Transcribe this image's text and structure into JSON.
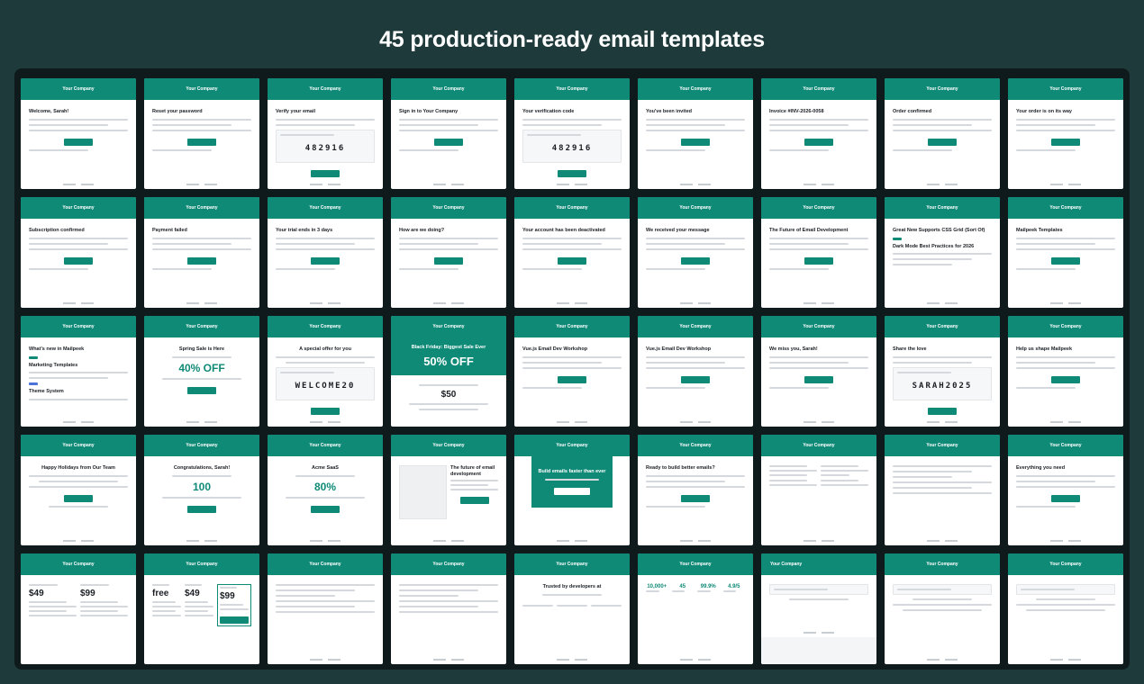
{
  "page": {
    "title": "45 production-ready email templates"
  },
  "card_header": "Your Company",
  "cards": [
    {
      "title": "Welcome, Sarah!"
    },
    {
      "title": "Reset your password"
    },
    {
      "title": "Verify your email",
      "code": "482916"
    },
    {
      "title": "Sign in to Your Company"
    },
    {
      "title": "Your verification code",
      "code": "482916"
    },
    {
      "title": "You've been invited"
    },
    {
      "title": "Invoice #INV-2026-0058"
    },
    {
      "title": "Order confirmed"
    },
    {
      "title": "Your order is on its way"
    },
    {
      "title": "Subscription confirmed"
    },
    {
      "title": "Payment failed"
    },
    {
      "title": "Your trial ends in 3 days"
    },
    {
      "title": "How are we doing?"
    },
    {
      "title": "Your account has been deactivated"
    },
    {
      "title": "We received your message"
    },
    {
      "title": "The Future of Email Development"
    },
    {
      "title": "Great New Supports CSS Grid (Sort Of)",
      "sub": "Dark Mode Best Practices for 2026"
    },
    {
      "title": "Mailpeek Templates"
    },
    {
      "title": "What's new in Mailpeek",
      "sub": "Marketing Templates",
      "sub2": "Theme System"
    },
    {
      "title": "Spring Sale is Here",
      "big": "40% OFF"
    },
    {
      "title": "A special offer for you",
      "code": "WELCOME20"
    },
    {
      "title": "Black Friday: Biggest Sale Ever",
      "big": "50% OFF",
      "price": "$50"
    },
    {
      "title": "Vue.js Email Dev Workshop"
    },
    {
      "title": "Vue.js Email Dev Workshop"
    },
    {
      "title": "We miss you, Sarah!"
    },
    {
      "title": "Share the love",
      "code": "SARAH2025"
    },
    {
      "title": "Help us shape Mailpeek"
    },
    {
      "title": "Happy Holidays from Our Team"
    },
    {
      "title": "Congratulations, Sarah!",
      "big": "100"
    },
    {
      "title": "Acme SaaS",
      "big": "80%"
    },
    {
      "title": "The future of email development"
    },
    {
      "title": "Build emails faster than ever"
    },
    {
      "title": "Ready to build better emails?"
    },
    {
      "title": ""
    },
    {
      "title": ""
    },
    {
      "title": "Everything you need"
    },
    {
      "title": "",
      "price": "$49",
      "price2": "$99"
    },
    {
      "title": "",
      "price": "free",
      "price2": "$49",
      "price3": "$99"
    },
    {
      "title": ""
    },
    {
      "title": ""
    },
    {
      "title": "Trusted by developers at"
    },
    {
      "title": "",
      "stats": [
        "10,000+",
        "45",
        "99.9%",
        "4.9/5"
      ]
    },
    {
      "title": ""
    },
    {
      "title": ""
    },
    {
      "title": ""
    }
  ],
  "colors": {
    "brand": "#0f8a77",
    "background": "#1e3a3a",
    "board": "#0f1a1c"
  }
}
